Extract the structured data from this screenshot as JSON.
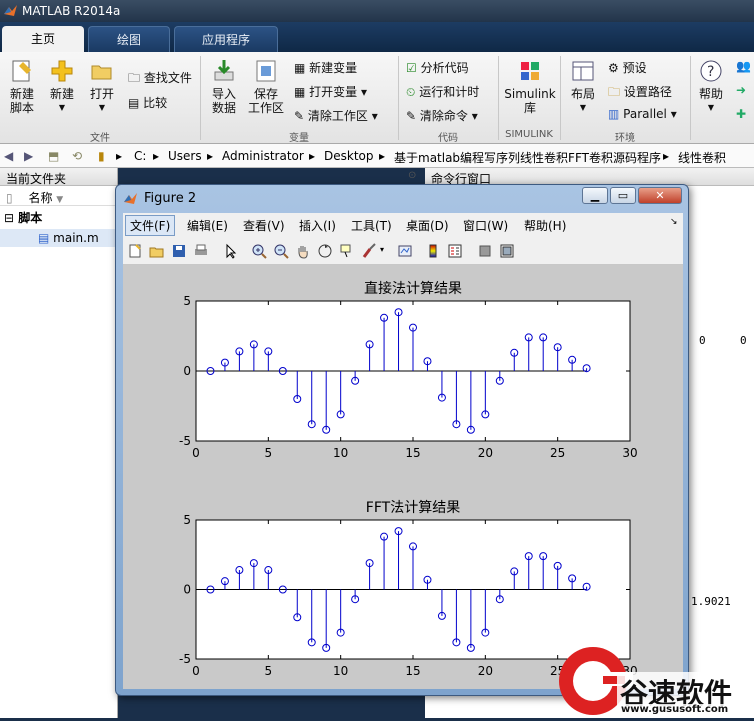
{
  "app": {
    "title": "MATLAB R2014a"
  },
  "tabs": [
    "主页",
    "绘图",
    "应用程序"
  ],
  "ribbon": {
    "new_script": [
      "新建",
      "脚本"
    ],
    "new": "新建",
    "open": "打开",
    "find_files": "查找文件",
    "compare": "比较",
    "import": [
      "导入",
      "数据"
    ],
    "save_workspace": [
      "保存",
      "工作区"
    ],
    "new_variable": "新建变量",
    "open_variable": "打开变量",
    "clear_workspace": "清除工作区",
    "analyze_code": "分析代码",
    "run_and_time": "运行和计时",
    "clear_commands": "清除命令",
    "simulink": [
      "Simulink",
      "库"
    ],
    "layout": "布局",
    "preferences": "预设",
    "set_path": "设置路径",
    "parallel": "Parallel",
    "help": "帮助",
    "groups": {
      "file": "文件",
      "variable": "变量",
      "code": "代码",
      "simulink": "SIMULINK",
      "environment": "环境"
    }
  },
  "path": [
    "C:",
    "Users",
    "Administrator",
    "Desktop",
    "基于matlab编程写序列线性卷积FFT卷积源码程序",
    "线性卷积"
  ],
  "left_panel": {
    "title": "当前文件夹",
    "col_name": "名称",
    "folder": "脚本",
    "file": "main.m"
  },
  "right_panel": {
    "title": "命令行窗口",
    "values": [
      "0",
      "0",
      "1.9021"
    ]
  },
  "figure": {
    "title": "Figure 2",
    "menu": [
      "文件(F)",
      "编辑(E)",
      "查看(V)",
      "插入(I)",
      "工具(T)",
      "桌面(D)",
      "窗口(W)",
      "帮助(H)"
    ]
  },
  "watermark": {
    "text": "谷速软件",
    "url": "www.gususoft.com"
  },
  "chart_data": [
    {
      "type": "stem",
      "title": "直接法计算结果",
      "xlim": [
        0,
        30
      ],
      "ylim": [
        -5,
        5
      ],
      "xticks": [
        0,
        5,
        10,
        15,
        20,
        25,
        30
      ],
      "yticks": [
        -5,
        0,
        5
      ],
      "color": "#0000cc",
      "x": [
        1,
        2,
        3,
        4,
        5,
        6,
        7,
        8,
        9,
        10,
        11,
        12,
        13,
        14,
        15,
        16,
        17,
        18,
        19,
        20,
        21,
        22,
        23,
        24,
        25,
        26,
        27
      ],
      "y": [
        0,
        0.6,
        1.4,
        1.9,
        1.4,
        0,
        -2.0,
        -3.8,
        -4.2,
        -3.1,
        -0.7,
        1.9,
        3.8,
        4.2,
        3.1,
        0.7,
        -1.9,
        -3.8,
        -4.2,
        -3.1,
        -0.7,
        1.3,
        2.4,
        2.4,
        1.7,
        0.8,
        0.2
      ]
    },
    {
      "type": "stem",
      "title": "FFT法计算结果",
      "xlim": [
        0,
        30
      ],
      "ylim": [
        -5,
        5
      ],
      "xticks": [
        0,
        5,
        10,
        15,
        20,
        25,
        30
      ],
      "yticks": [
        -5,
        0,
        5
      ],
      "color": "#0000cc",
      "x": [
        1,
        2,
        3,
        4,
        5,
        6,
        7,
        8,
        9,
        10,
        11,
        12,
        13,
        14,
        15,
        16,
        17,
        18,
        19,
        20,
        21,
        22,
        23,
        24,
        25,
        26,
        27
      ],
      "y": [
        0,
        0.6,
        1.4,
        1.9,
        1.4,
        0,
        -2.0,
        -3.8,
        -4.2,
        -3.1,
        -0.7,
        1.9,
        3.8,
        4.2,
        3.1,
        0.7,
        -1.9,
        -3.8,
        -4.2,
        -3.1,
        -0.7,
        1.3,
        2.4,
        2.4,
        1.7,
        0.8,
        0.2
      ]
    }
  ]
}
